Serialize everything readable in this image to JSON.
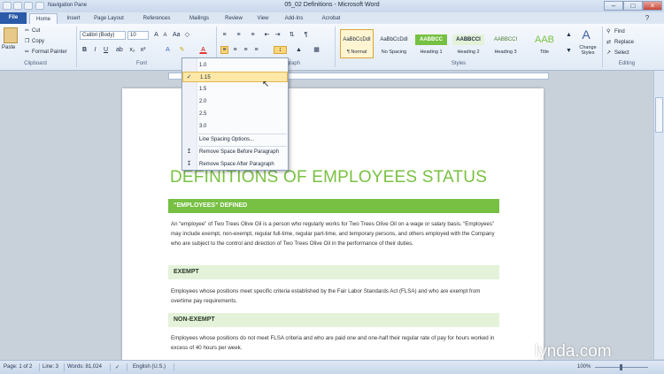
{
  "window": {
    "title": "05_02 Definitions - Microsoft Word",
    "nav_pane_label": "Navigation Pane"
  },
  "tabs": [
    {
      "label": "File"
    },
    {
      "label": "Home"
    },
    {
      "label": "Insert"
    },
    {
      "label": "Page Layout"
    },
    {
      "label": "References"
    },
    {
      "label": "Mailings"
    },
    {
      "label": "Review"
    },
    {
      "label": "View"
    },
    {
      "label": "Add-Ins"
    },
    {
      "label": "Acrobat"
    }
  ],
  "clipboard": {
    "paste_label": "Paste",
    "cut_label": "Cut",
    "copy_label": "Copy",
    "format_painter_label": "Format Painter",
    "group_label": "Clipboard"
  },
  "font": {
    "font_name": "Calibri (Body)",
    "font_size": "10",
    "group_label": "Font"
  },
  "paragraph": {
    "group_label": "Paragraph"
  },
  "styles": {
    "group_label": "Styles",
    "items": [
      {
        "sample": "AaBbCcDdI",
        "name": "¶ Normal"
      },
      {
        "sample": "AaBbCcDdI",
        "name": "No Spacing"
      },
      {
        "sample": "AABBCC",
        "name": "Heading 1"
      },
      {
        "sample": "AABBCCI",
        "name": "Heading 2"
      },
      {
        "sample": "AABBCCI",
        "name": "Heading 3"
      },
      {
        "sample": "AAB",
        "name": "Title"
      }
    ],
    "change_styles_label": "Change Styles"
  },
  "editing": {
    "group_label": "Editing",
    "find_label": "Find",
    "replace_label": "Replace",
    "select_label": "Select"
  },
  "line_spacing_menu": {
    "options": [
      "1.0",
      "1.15",
      "1.5",
      "2.0",
      "2.5",
      "3.0"
    ],
    "selected": "1.15",
    "line_spacing_options": "Line Spacing Options...",
    "remove_before": "Remove Space Before Paragraph",
    "remove_after": "Remove Space After Paragraph"
  },
  "document": {
    "title": "DEFINITIONS OF EMPLOYEES STATUS",
    "sections": [
      {
        "heading": "“EMPLOYEES” DEFINED",
        "text": "An “employee” of Two Trees Olive Oil is a person who regularly works for Two Trees Olive Oil on a wage or salary basis. “Employees” may include exempt, non-exempt, regular full-time, regular part-time, and temporary persons, and others employed with the Company who are subject to the control and direction of Two Trees Olive Oil in the performance of their duties."
      },
      {
        "heading": "EXEMPT",
        "text": "Employees whose positions meet specific criteria established by the Fair Labor Standards Act (FLSA) and who are exempt from overtime pay requirements."
      },
      {
        "heading": "NON-EXEMPT",
        "text": "Employees whose positions do not meet FLSA criteria and who are paid one and one-half their regular rate of pay for hours worked in excess of 40 hours per week."
      }
    ]
  },
  "status": {
    "page": "Page: 1 of 2",
    "line": "Line: 3",
    "words": "Words: 81,024",
    "language": "English (U.S.)",
    "zoom": "100%"
  },
  "watermark": "lynda.com",
  "colors": {
    "accent_green": "#77c043",
    "light_green": "#e4f2d9",
    "file_tab": "#2a5aa8"
  }
}
